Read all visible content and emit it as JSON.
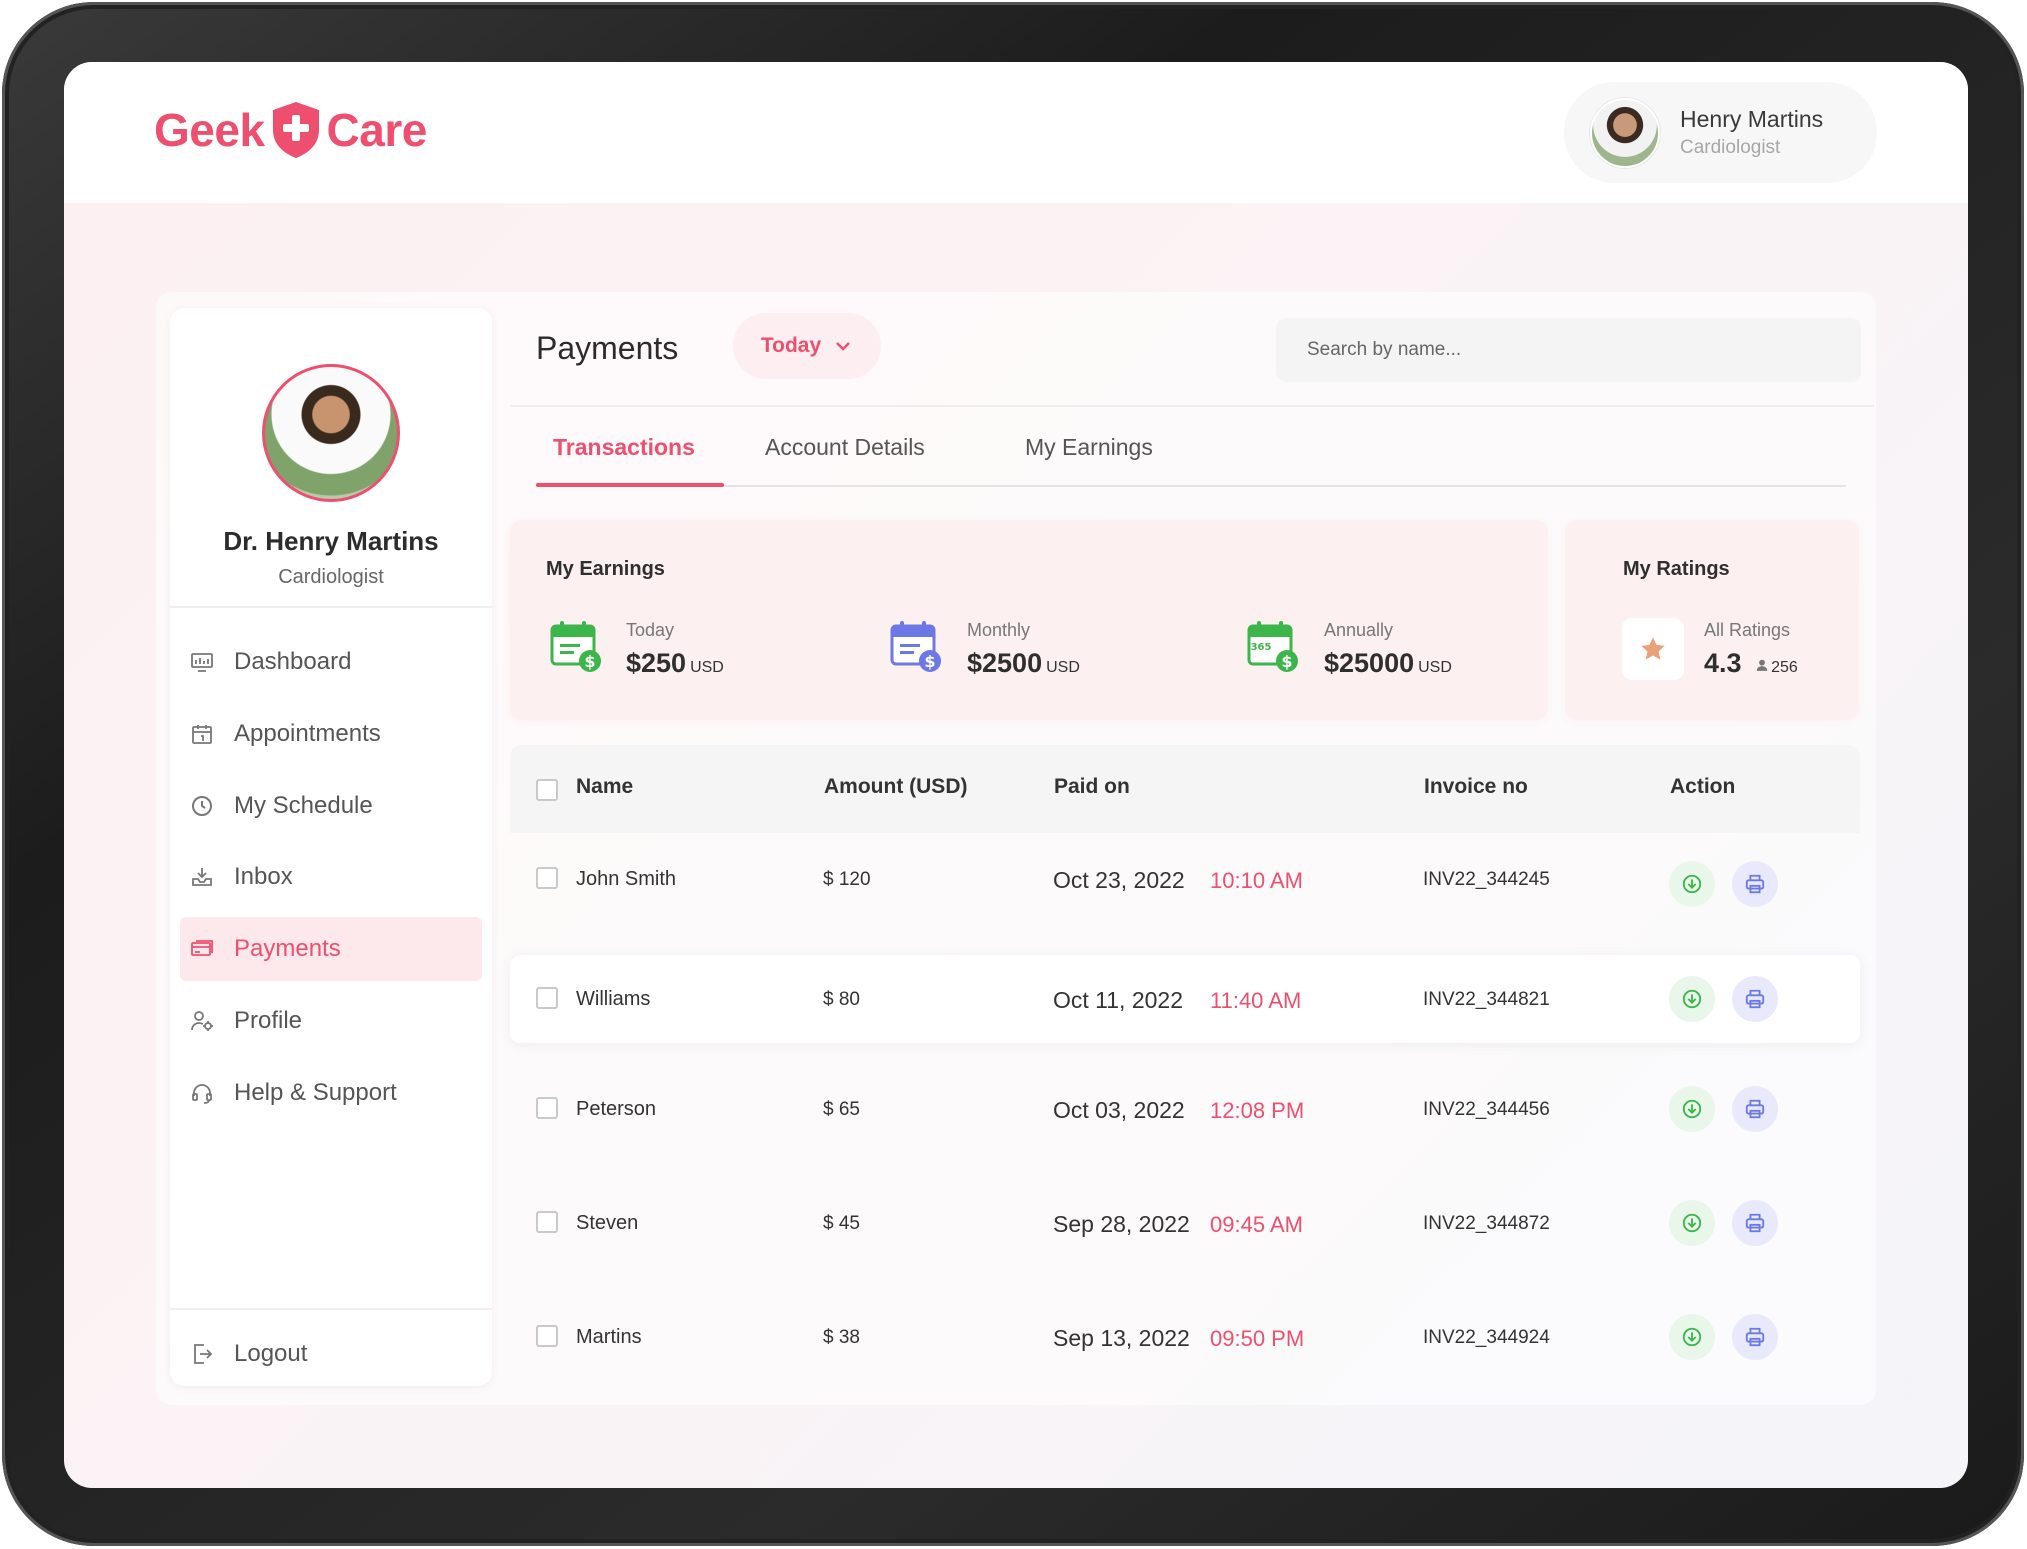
{
  "brand": {
    "name_left": "Geek",
    "name_right": "Care",
    "color": "#ef4f6e"
  },
  "user": {
    "name": "Henry Martins",
    "role": "Cardiologist"
  },
  "sidebar": {
    "doctor_name": "Dr. Henry Martins",
    "doctor_role": "Cardiologist",
    "items": [
      {
        "label": "Dashboard",
        "icon": "dashboard-icon"
      },
      {
        "label": "Appointments",
        "icon": "calendar-icon"
      },
      {
        "label": "My Schedule",
        "icon": "clock-icon"
      },
      {
        "label": "Inbox",
        "icon": "inbox-icon"
      },
      {
        "label": "Payments",
        "icon": "credit-card-icon",
        "active": true
      },
      {
        "label": "Profile",
        "icon": "user-settings-icon"
      },
      {
        "label": "Help & Support",
        "icon": "headset-icon"
      }
    ],
    "logout": "Logout"
  },
  "page": {
    "title": "Payments",
    "filter": "Today",
    "search_placeholder": "Search by name...",
    "tabs": [
      "Transactions",
      "Account Details",
      "My Earnings"
    ],
    "active_tab": "Transactions"
  },
  "earnings": {
    "title": "My Earnings",
    "today": {
      "label": "Today",
      "value": "$250",
      "unit": "USD"
    },
    "monthly": {
      "label": "Monthly",
      "value": "$2500",
      "unit": "USD"
    },
    "annually": {
      "label": "Annually",
      "value": "$25000",
      "unit": "USD"
    }
  },
  "ratings": {
    "title": "My Ratings",
    "label": "All Ratings",
    "value": "4.3",
    "count": "256"
  },
  "table": {
    "headers": [
      "Name",
      "Amount (USD)",
      "Paid on",
      "Invoice no",
      "Action"
    ],
    "rows": [
      {
        "name": "John Smith",
        "amount": "$ 120",
        "date": "Oct 23, 2022",
        "time": "10:10 AM",
        "invoice": "INV22_344245"
      },
      {
        "name": "Williams",
        "amount": "$ 80",
        "date": "Oct 11, 2022",
        "time": "11:40 AM",
        "invoice": "INV22_344821"
      },
      {
        "name": "Peterson",
        "amount": "$ 65",
        "date": "Oct 03, 2022",
        "time": "12:08 PM",
        "invoice": "INV22_344456"
      },
      {
        "name": "Steven",
        "amount": "$ 45",
        "date": "Sep 28, 2022",
        "time": "09:45 AM",
        "invoice": "INV22_344872"
      },
      {
        "name": "Martins",
        "amount": "$ 38",
        "date": "Sep 13, 2022",
        "time": "09:50 PM",
        "invoice": "INV22_344924"
      }
    ]
  }
}
